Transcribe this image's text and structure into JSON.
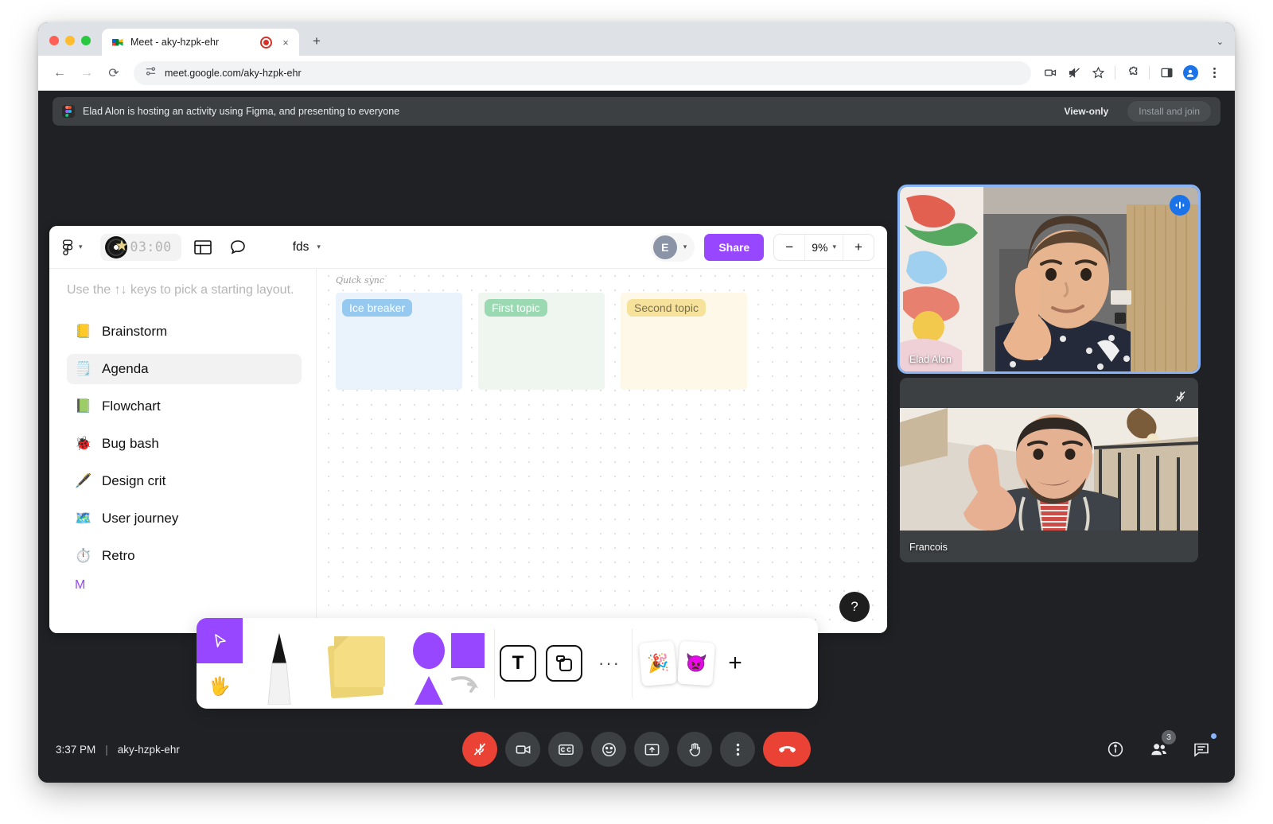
{
  "browser": {
    "tab": {
      "title": "Meet - aky-hzpk-ehr",
      "favicon_name": "google-meet-favicon",
      "recording_indicator": "recording-tab-icon",
      "close_label": "×"
    },
    "new_tab_label": "+",
    "tabstrip_menu": "⌄",
    "nav": {
      "back": "←",
      "forward": "→",
      "reload": "⟳"
    },
    "url": "meet.google.com/aky-hzpk-ehr",
    "site_info_icon": "site-settings-icon",
    "toolbar_icons": [
      "camera-blocked-icon",
      "sound-muted-icon",
      "bookmark-star-icon",
      "extensions-puzzle-icon",
      "side-panel-icon",
      "profile-avatar-icon",
      "browser-menu-icon"
    ]
  },
  "banner": {
    "app_icon": "figma-icon",
    "message": "Elad Alon is hosting an activity using Figma, and presenting to everyone",
    "view_only_label": "View-only",
    "install_button_label": "Install and join"
  },
  "figjam": {
    "logo_name": "figma-logo-icon",
    "timer": {
      "value": "03:00",
      "disc_icon": "music-disc-icon",
      "star_icon": "star-icon"
    },
    "layout_icon": "panel-layout-icon",
    "comment_icon": "comment-bubble-icon",
    "file_name": "fds",
    "avatar_initial": "E",
    "share_label": "Share",
    "zoom": {
      "minus": "−",
      "value": "9%",
      "plus": "+"
    },
    "panel": {
      "hint": "Use the ↑↓ keys to pick a starting layout.",
      "templates": [
        {
          "emoji": "📒",
          "label": "Brainstorm",
          "selected": false
        },
        {
          "emoji": "🗒️",
          "label": "Agenda",
          "selected": true
        },
        {
          "emoji": "📗",
          "label": "Flowchart",
          "selected": false
        },
        {
          "emoji": "🐞",
          "label": "Bug bash",
          "selected": false
        },
        {
          "emoji": "🖋️",
          "label": "Design crit",
          "selected": false
        },
        {
          "emoji": "🗺️",
          "label": "User journey",
          "selected": false
        },
        {
          "emoji": "⏱️",
          "label": "Retro",
          "selected": false
        }
      ],
      "more_link": "M"
    },
    "canvas": {
      "frame_label": "Quick sync",
      "columns": [
        {
          "title": "Ice breaker",
          "color": "blue"
        },
        {
          "title": "First topic",
          "color": "green"
        },
        {
          "title": "Second topic",
          "color": "yellow"
        }
      ]
    },
    "help_label": "?",
    "dock": {
      "cursor_icon": "cursor-arrow-icon",
      "hand_icon": "hand-grab-icon",
      "pen_icon": "marker-pen-icon",
      "sticky_icon": "sticky-note-icon",
      "shapes_icon": "shapes-icon",
      "text_label": "T",
      "section_icon": "section-frame-icon",
      "more_label": "···",
      "sticker_a": "party-sticker-icon",
      "sticker_b": "monster-sticker-icon",
      "plus_label": "+"
    }
  },
  "participants": [
    {
      "name": "Elad Alon",
      "speaking": true,
      "badge": "audio-active-icon",
      "muted": false
    },
    {
      "name": "Francois",
      "speaking": false,
      "badge": "mic-muted-icon",
      "muted": true
    }
  ],
  "bottom_bar": {
    "time": "3:37 PM",
    "separator": "|",
    "meeting_code": "aky-hzpk-ehr",
    "controls": [
      {
        "name": "microphone-button",
        "icon": "mic-muted-icon",
        "state": "muted"
      },
      {
        "name": "camera-button",
        "icon": "camera-icon",
        "state": "on"
      },
      {
        "name": "captions-button",
        "icon": "closed-captions-icon",
        "state": "off"
      },
      {
        "name": "reactions-button",
        "icon": "emoji-smiley-icon",
        "state": "off"
      },
      {
        "name": "present-button",
        "icon": "present-screen-icon",
        "state": "off"
      },
      {
        "name": "raise-hand-button",
        "icon": "raise-hand-icon",
        "state": "off"
      },
      {
        "name": "more-options-button",
        "icon": "more-vertical-icon",
        "state": "off"
      },
      {
        "name": "end-call-button",
        "icon": "end-call-icon",
        "state": "danger"
      }
    ],
    "right_controls": [
      {
        "name": "meeting-details-button",
        "icon": "info-icon",
        "badge": ""
      },
      {
        "name": "participants-button",
        "icon": "people-icon",
        "badge": "3"
      },
      {
        "name": "chat-button",
        "icon": "chat-icon",
        "badge": ""
      }
    ]
  }
}
